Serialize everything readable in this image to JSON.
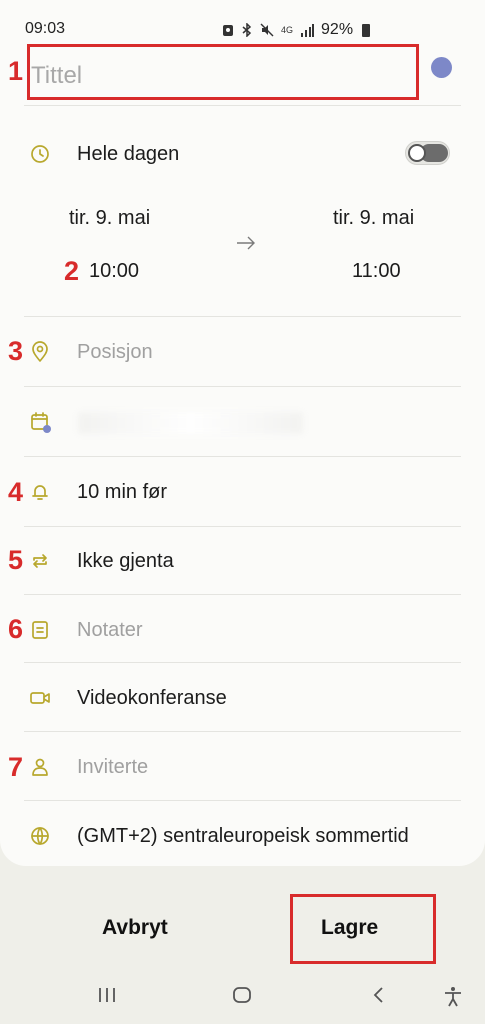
{
  "status_bar": {
    "time": "09:03",
    "battery": "92%",
    "network": "4G"
  },
  "title": {
    "placeholder": "Tittel",
    "color_dot": "#7d88c8"
  },
  "all_day": {
    "label": "Hele dagen",
    "enabled": false
  },
  "start": {
    "date": "tir. 9. mai",
    "time": "10:00"
  },
  "end": {
    "date": "tir. 9. mai",
    "time": "11:00"
  },
  "location": {
    "placeholder": "Posisjon"
  },
  "reminder": {
    "label": "10 min før"
  },
  "repeat": {
    "label": "Ikke gjenta"
  },
  "notes": {
    "placeholder": "Notater"
  },
  "video": {
    "label": "Videokonferanse"
  },
  "invitees": {
    "placeholder": "Inviterte"
  },
  "timezone": {
    "label": "(GMT+2) sentraleuropeisk sommertid"
  },
  "footer": {
    "cancel_label": "Avbryt",
    "save_label": "Lagre"
  },
  "annotations": [
    "1",
    "2",
    "3",
    "4",
    "5",
    "6",
    "7"
  ],
  "colors": {
    "accent_icon": "#b8a82e",
    "annotation_red": "#d82b2b",
    "background": "#efefe9"
  },
  "icons": [
    "clock-icon",
    "arrow-right-icon",
    "location-pin-icon",
    "calendar-icon",
    "bell-icon",
    "repeat-icon",
    "note-icon",
    "video-icon",
    "person-icon",
    "globe-icon",
    "recent-apps-icon",
    "home-icon",
    "back-icon",
    "accessibility-icon"
  ]
}
